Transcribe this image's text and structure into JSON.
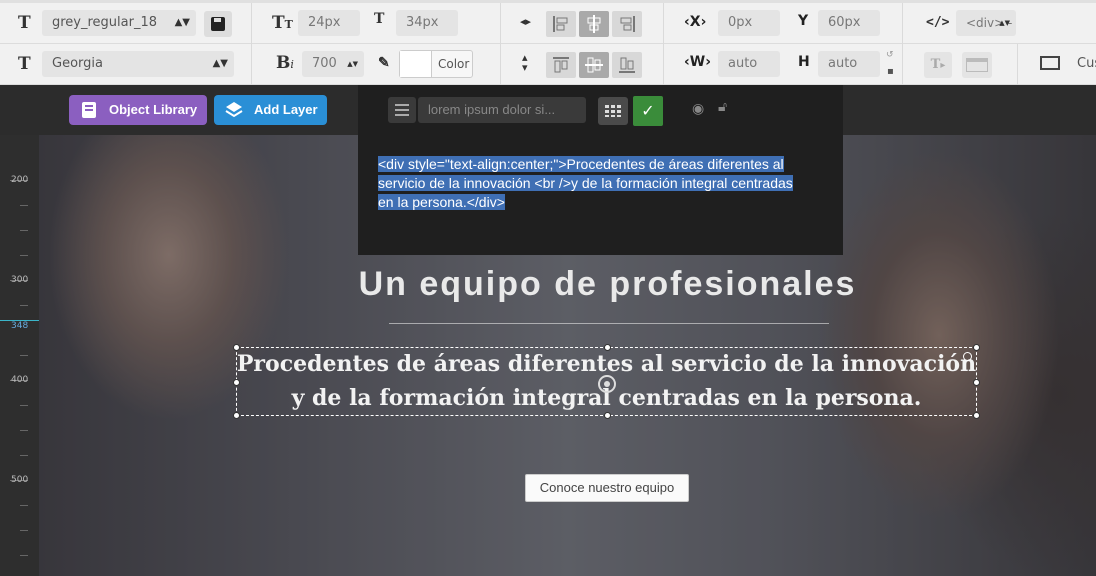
{
  "toolbar": {
    "style_name": "grey_regular_18",
    "font_size": "24px",
    "line_height": "34px",
    "x_label": "X",
    "x_value": "0px",
    "y_label": "Y",
    "y_value": "60px",
    "tag": "<div> -",
    "font_family": "Georgia",
    "font_weight": "700",
    "color_label": "Color",
    "w_label": "W",
    "w_value": "auto",
    "h_label": "H",
    "h_value": "auto",
    "custom_truncated": "Cus"
  },
  "darkbar": {
    "object_library": "Object Library",
    "add_layer": "Add Layer",
    "layer_name_placeholder": "lorem ipsum dolor si..."
  },
  "code": {
    "line1": "<div style=\"text-align:center;\">Procedentes de áreas diferentes al",
    "line2": "servicio de la innovación <br />y de la formación integral centradas",
    "line3": "en la persona.</div>"
  },
  "ruler": {
    "labels": [
      "200",
      "300",
      "348",
      "400",
      "500"
    ]
  },
  "canvas": {
    "title": "Un equipo de profesionales",
    "text_line1": "Procedentes de áreas diferentes al servicio de la innovación",
    "text_line2": "y de la formación integral centradas en la persona.",
    "button": "Conoce nuestro equipo"
  },
  "colors": {
    "purple": "#8b5fc0",
    "blue": "#2a8fd6",
    "green": "#3a8c3a",
    "selection": "#3f6fb4"
  }
}
